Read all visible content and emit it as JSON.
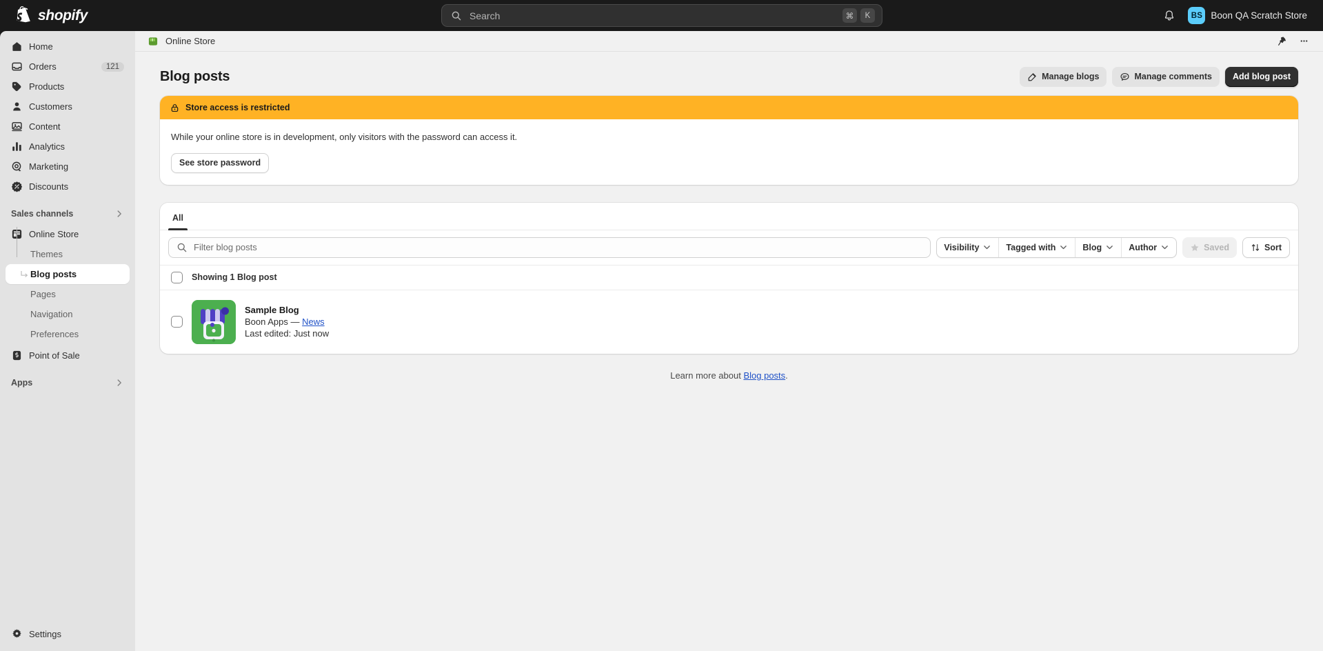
{
  "topbar": {
    "brand": "shopify",
    "search": {
      "placeholder": "Search",
      "key_cmd": "⌘",
      "key_letter": "K"
    },
    "account": {
      "initials": "BS",
      "store_name": "Boon QA Scratch Store"
    }
  },
  "sidebar": {
    "items": [
      {
        "label": "Home",
        "icon": "home-icon",
        "badge": ""
      },
      {
        "label": "Orders",
        "icon": "orders-icon",
        "badge": "121"
      },
      {
        "label": "Products",
        "icon": "products-icon",
        "badge": ""
      },
      {
        "label": "Customers",
        "icon": "customers-icon",
        "badge": ""
      },
      {
        "label": "Content",
        "icon": "content-icon",
        "badge": ""
      },
      {
        "label": "Analytics",
        "icon": "analytics-icon",
        "badge": ""
      },
      {
        "label": "Marketing",
        "icon": "marketing-icon",
        "badge": ""
      },
      {
        "label": "Discounts",
        "icon": "discounts-icon",
        "badge": ""
      }
    ],
    "sales_channels": {
      "label": "Sales channels"
    },
    "channels": [
      {
        "label": "Online Store",
        "icon": "storefront-icon"
      },
      {
        "label": "Point of Sale",
        "icon": "pos-icon"
      }
    ],
    "online_store_sub": [
      {
        "label": "Themes",
        "active": false
      },
      {
        "label": "Blog posts",
        "active": true
      },
      {
        "label": "Pages",
        "active": false
      },
      {
        "label": "Navigation",
        "active": false
      },
      {
        "label": "Preferences",
        "active": false
      }
    ],
    "apps": {
      "label": "Apps"
    },
    "settings": {
      "label": "Settings",
      "icon": "gear-icon"
    }
  },
  "breadcrumb": {
    "label": "Online Store",
    "pin_icon": "pin-icon",
    "more_icon": "ellipsis-icon"
  },
  "page": {
    "title": "Blog posts",
    "actions": [
      {
        "label": "Manage blogs",
        "icon": "edit-icon",
        "style": "secondary"
      },
      {
        "label": "Manage comments",
        "icon": "comment-icon",
        "style": "secondary"
      },
      {
        "label": "Add blog post",
        "icon": "",
        "style": "primary"
      }
    ]
  },
  "banner": {
    "icon": "lock-icon",
    "title": "Store access is restricted",
    "body": "While your online store is in development, only visitors with the password can access it.",
    "button": "See store password",
    "accent_color": "#ffb224"
  },
  "list": {
    "tabs": [
      {
        "label": "All",
        "active": true
      }
    ],
    "filter": {
      "placeholder": "Filter blog posts",
      "value": "",
      "icon": "search-icon"
    },
    "filters": [
      {
        "label": "Visibility",
        "icon": "chevron-down-icon"
      },
      {
        "label": "Tagged with",
        "icon": "chevron-down-icon"
      },
      {
        "label": "Blog",
        "icon": "chevron-down-icon"
      },
      {
        "label": "Author",
        "icon": "chevron-down-icon"
      }
    ],
    "saved_button": {
      "label": "Saved",
      "icon": "star-icon",
      "disabled": true
    },
    "sort_button": {
      "label": "Sort",
      "icon": "sort-icon"
    },
    "header_label": "Showing 1 Blog post",
    "rows": [
      {
        "title": "Sample Blog",
        "author": "Boon Apps",
        "separator": "—",
        "blog": "News",
        "meta": "Last edited: Just now",
        "thumb_icon": "storefront-thumb"
      }
    ]
  },
  "footer": {
    "prefix": "Learn more about ",
    "link": "Blog posts",
    "suffix": "."
  }
}
